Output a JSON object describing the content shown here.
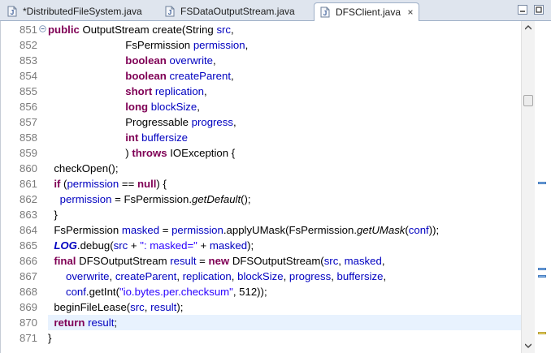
{
  "tabs": [
    {
      "label": "*DistributedFileSystem.java",
      "active": false
    },
    {
      "label": "FSDataOutputStream.java",
      "active": false
    },
    {
      "label": "DFSClient.java",
      "active": true
    }
  ],
  "colors": {
    "keyword": "#7f0055",
    "variable": "#0000c0",
    "string": "#2a00ff",
    "current_line": "#e8f2fe"
  },
  "editor": {
    "current_line": "870",
    "lines": [
      {
        "num": "851",
        "tokens": [
          {
            "t": "kw",
            "v": "public"
          },
          {
            "t": "",
            "v": " OutputStream create(String "
          },
          {
            "t": "var",
            "v": "src"
          },
          {
            "t": "",
            "v": ","
          }
        ]
      },
      {
        "num": "852",
        "tokens": [
          {
            "t": "",
            "v": "                          FsPermission "
          },
          {
            "t": "var",
            "v": "permission"
          },
          {
            "t": "",
            "v": ","
          }
        ]
      },
      {
        "num": "853",
        "tokens": [
          {
            "t": "",
            "v": "                          "
          },
          {
            "t": "kw",
            "v": "boolean"
          },
          {
            "t": "",
            "v": " "
          },
          {
            "t": "var",
            "v": "overwrite"
          },
          {
            "t": "",
            "v": ","
          }
        ]
      },
      {
        "num": "854",
        "tokens": [
          {
            "t": "",
            "v": "                          "
          },
          {
            "t": "kw",
            "v": "boolean"
          },
          {
            "t": "",
            "v": " "
          },
          {
            "t": "var",
            "v": "createParent"
          },
          {
            "t": "",
            "v": ","
          }
        ]
      },
      {
        "num": "855",
        "tokens": [
          {
            "t": "",
            "v": "                          "
          },
          {
            "t": "kw",
            "v": "short"
          },
          {
            "t": "",
            "v": " "
          },
          {
            "t": "var",
            "v": "replication"
          },
          {
            "t": "",
            "v": ","
          }
        ]
      },
      {
        "num": "856",
        "tokens": [
          {
            "t": "",
            "v": "                          "
          },
          {
            "t": "kw",
            "v": "long"
          },
          {
            "t": "",
            "v": " "
          },
          {
            "t": "var",
            "v": "blockSize"
          },
          {
            "t": "",
            "v": ","
          }
        ]
      },
      {
        "num": "857",
        "tokens": [
          {
            "t": "",
            "v": "                          Progressable "
          },
          {
            "t": "var",
            "v": "progress"
          },
          {
            "t": "",
            "v": ","
          }
        ]
      },
      {
        "num": "858",
        "tokens": [
          {
            "t": "",
            "v": "                          "
          },
          {
            "t": "kw",
            "v": "int"
          },
          {
            "t": "",
            "v": " "
          },
          {
            "t": "var",
            "v": "buffersize"
          }
        ]
      },
      {
        "num": "859",
        "tokens": [
          {
            "t": "",
            "v": "                          ) "
          },
          {
            "t": "kw",
            "v": "throws"
          },
          {
            "t": "",
            "v": " IOException {"
          }
        ]
      },
      {
        "num": "860",
        "tokens": [
          {
            "t": "",
            "v": "  checkOpen();"
          }
        ]
      },
      {
        "num": "861",
        "tokens": [
          {
            "t": "",
            "v": "  "
          },
          {
            "t": "kw",
            "v": "if"
          },
          {
            "t": "",
            "v": " ("
          },
          {
            "t": "var",
            "v": "permission"
          },
          {
            "t": "",
            "v": " == "
          },
          {
            "t": "kw",
            "v": "null"
          },
          {
            "t": "",
            "v": ") {"
          }
        ]
      },
      {
        "num": "862",
        "tokens": [
          {
            "t": "",
            "v": "    "
          },
          {
            "t": "var",
            "v": "permission"
          },
          {
            "t": "",
            "v": " = FsPermission."
          },
          {
            "t": "it",
            "v": "getDefault"
          },
          {
            "t": "",
            "v": "();"
          }
        ]
      },
      {
        "num": "863",
        "tokens": [
          {
            "t": "",
            "v": "  }"
          }
        ]
      },
      {
        "num": "864",
        "tokens": [
          {
            "t": "",
            "v": "  FsPermission "
          },
          {
            "t": "var",
            "v": "masked"
          },
          {
            "t": "",
            "v": " = "
          },
          {
            "t": "var",
            "v": "permission"
          },
          {
            "t": "",
            "v": ".applyUMask(FsPermission."
          },
          {
            "t": "it",
            "v": "getUMask"
          },
          {
            "t": "",
            "v": "("
          },
          {
            "t": "var",
            "v": "conf"
          },
          {
            "t": "",
            "v": "));"
          }
        ]
      },
      {
        "num": "865",
        "tokens": [
          {
            "t": "",
            "v": "  "
          },
          {
            "t": "fld",
            "v": "LOG"
          },
          {
            "t": "",
            "v": ".debug("
          },
          {
            "t": "var",
            "v": "src"
          },
          {
            "t": "",
            "v": " + "
          },
          {
            "t": "str",
            "v": "\": masked=\""
          },
          {
            "t": "",
            "v": " + "
          },
          {
            "t": "var",
            "v": "masked"
          },
          {
            "t": "",
            "v": ");"
          }
        ]
      },
      {
        "num": "866",
        "tokens": [
          {
            "t": "",
            "v": "  "
          },
          {
            "t": "kw",
            "v": "final"
          },
          {
            "t": "",
            "v": " DFSOutputStream "
          },
          {
            "t": "var",
            "v": "result"
          },
          {
            "t": "",
            "v": " = "
          },
          {
            "t": "kw",
            "v": "new"
          },
          {
            "t": "",
            "v": " DFSOutputStream("
          },
          {
            "t": "var",
            "v": "src"
          },
          {
            "t": "",
            "v": ", "
          },
          {
            "t": "var",
            "v": "masked"
          },
          {
            "t": "",
            "v": ","
          }
        ]
      },
      {
        "num": "867",
        "tokens": [
          {
            "t": "",
            "v": "      "
          },
          {
            "t": "var",
            "v": "overwrite"
          },
          {
            "t": "",
            "v": ", "
          },
          {
            "t": "var",
            "v": "createParent"
          },
          {
            "t": "",
            "v": ", "
          },
          {
            "t": "var",
            "v": "replication"
          },
          {
            "t": "",
            "v": ", "
          },
          {
            "t": "var",
            "v": "blockSize"
          },
          {
            "t": "",
            "v": ", "
          },
          {
            "t": "var",
            "v": "progress"
          },
          {
            "t": "",
            "v": ", "
          },
          {
            "t": "var",
            "v": "buffersize"
          },
          {
            "t": "",
            "v": ","
          }
        ]
      },
      {
        "num": "868",
        "tokens": [
          {
            "t": "",
            "v": "      "
          },
          {
            "t": "var",
            "v": "conf"
          },
          {
            "t": "",
            "v": ".getInt("
          },
          {
            "t": "str",
            "v": "\"io.bytes.per.checksum\""
          },
          {
            "t": "",
            "v": ", 512));"
          }
        ]
      },
      {
        "num": "869",
        "tokens": [
          {
            "t": "",
            "v": "  beginFileLease("
          },
          {
            "t": "var",
            "v": "src"
          },
          {
            "t": "",
            "v": ", "
          },
          {
            "t": "var",
            "v": "result"
          },
          {
            "t": "",
            "v": ");"
          }
        ]
      },
      {
        "num": "870",
        "tokens": [
          {
            "t": "",
            "v": "  "
          },
          {
            "t": "kw",
            "v": "return"
          },
          {
            "t": "",
            "v": " "
          },
          {
            "t": "var",
            "v": "result"
          },
          {
            "t": "",
            "v": ";"
          }
        ]
      },
      {
        "num": "871",
        "tokens": [
          {
            "t": "",
            "v": "}"
          }
        ]
      }
    ]
  }
}
